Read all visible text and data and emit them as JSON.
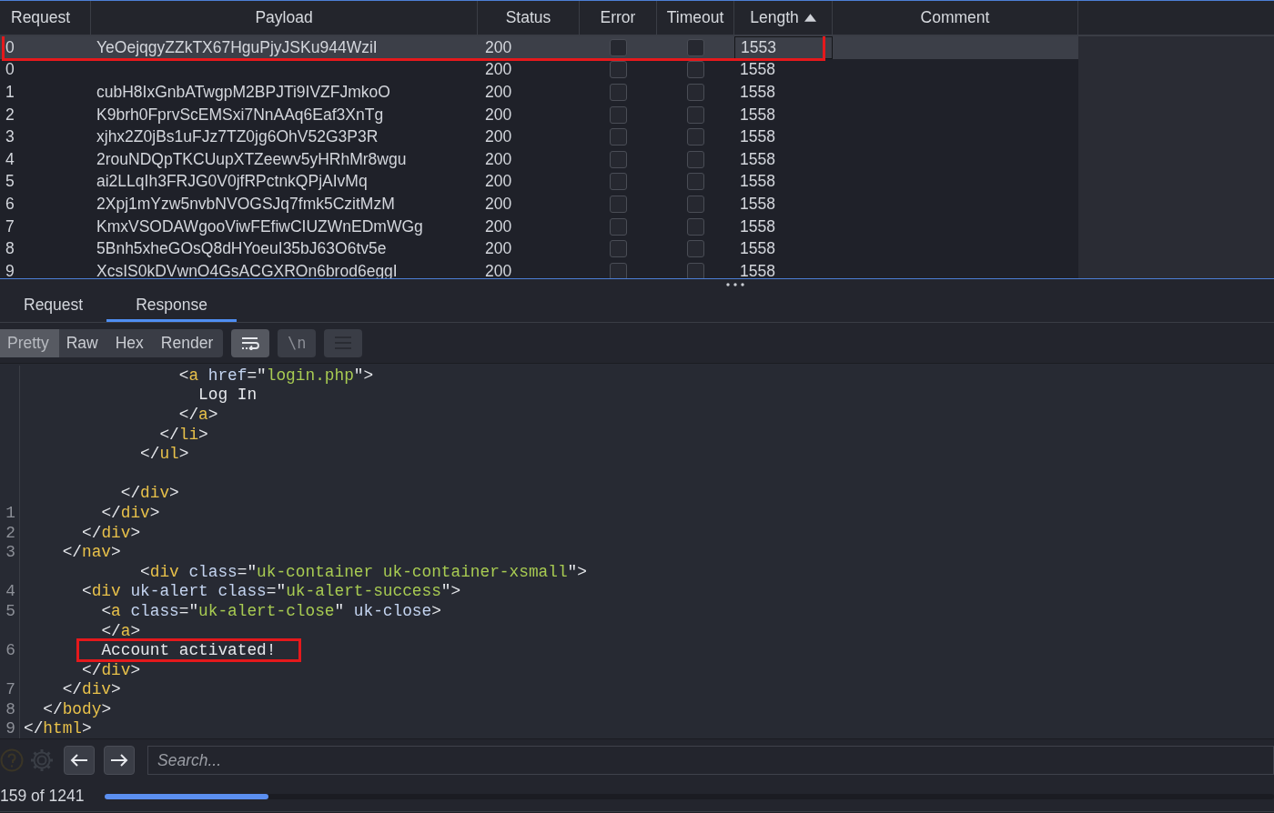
{
  "results_table": {
    "columns": [
      "Request",
      "Payload",
      "Status",
      "Error",
      "Timeout",
      "Length",
      "Comment"
    ],
    "rows": [
      {
        "request": "0",
        "payload": "YeOejqgyZZkTX67HguPjyJSKu944WziI",
        "status": "200",
        "error": false,
        "timeout": false,
        "length": "1553",
        "selected": true,
        "highlighted": true
      },
      {
        "request": "0",
        "status": "200",
        "error": false,
        "timeout": false,
        "length": "1558",
        "selected": false,
        "highlighted": false
      },
      {
        "request": "1",
        "payload": "cubH8IxGnbATwgpM2BPJTi9IVZFJmkoO",
        "status": "200",
        "error": false,
        "timeout": false,
        "length": "1558",
        "selected": false,
        "highlighted": false
      },
      {
        "request": "2",
        "payload": "K9brh0FprvScEMSxi7NnAAq6Eaf3XnTg",
        "status": "200",
        "error": false,
        "timeout": false,
        "length": "1558",
        "selected": false,
        "highlighted": false
      },
      {
        "request": "3",
        "payload": "xjhx2Z0jBs1uFJz7TZ0jg6OhV52G3P3R",
        "status": "200",
        "error": false,
        "timeout": false,
        "length": "1558",
        "selected": false,
        "highlighted": false
      },
      {
        "request": "4",
        "payload": "2rouNDQpTKCUupXTZeewv5yHRhMr8wgu",
        "status": "200",
        "error": false,
        "timeout": false,
        "length": "1558",
        "selected": false,
        "highlighted": false
      },
      {
        "request": "5",
        "payload": "ai2LLqIh3FRJG0V0jfRPctnkQPjAIvMq",
        "status": "200",
        "error": false,
        "timeout": false,
        "length": "1558",
        "selected": false,
        "highlighted": false
      },
      {
        "request": "6",
        "payload": "2Xpj1mYzw5nvbNVOGSJq7fmk5CzitMzM",
        "status": "200",
        "error": false,
        "timeout": false,
        "length": "1558",
        "selected": false,
        "highlighted": false
      },
      {
        "request": "7",
        "payload": "KmxVSODAWgooViwFEfiwCIUZWnEDmWGg",
        "status": "200",
        "error": false,
        "timeout": false,
        "length": "1558",
        "selected": false,
        "highlighted": false
      },
      {
        "request": "8",
        "payload": "5Bnh5xheGOsQ8dHYoeuI35bJ63O6tv5e",
        "status": "200",
        "error": false,
        "timeout": false,
        "length": "1558",
        "selected": false,
        "highlighted": false
      },
      {
        "request": "9",
        "payload": "XcsIS0kDVwnO4GsACGXROn6brod6eggI",
        "status": "200",
        "error": false,
        "timeout": false,
        "length": "1558",
        "selected": false,
        "highlighted": false
      }
    ]
  },
  "message_tabs": [
    {
      "label": "Request",
      "selected": false
    },
    {
      "label": "Response",
      "selected": true
    }
  ],
  "view_modes": [
    {
      "label": "Pretty",
      "selected": true
    },
    {
      "label": "Raw",
      "selected": false
    },
    {
      "label": "Hex",
      "selected": false
    },
    {
      "label": "Render",
      "selected": false
    }
  ],
  "view_options": [
    {
      "kind": "wrap",
      "on": true
    },
    {
      "kind": "newline",
      "label": "\\n",
      "on": false
    },
    {
      "kind": "menu",
      "on": false
    }
  ],
  "code_lines": [
    {
      "segs": [
        {
          "kind": "p",
          "t": "                <"
        },
        {
          "kind": "tag",
          "t": "a"
        },
        {
          "kind": "attr",
          "t": " href"
        },
        {
          "kind": "p",
          "t": "=\""
        },
        {
          "kind": "str",
          "t": "login.php"
        },
        {
          "kind": "p",
          "t": "\">"
        }
      ],
      "marked": false
    },
    {
      "segs": [
        {
          "kind": "text",
          "t": "                  Log In"
        }
      ],
      "marked": false
    },
    {
      "segs": [
        {
          "kind": "p",
          "t": "                </"
        },
        {
          "kind": "tag",
          "t": "a"
        },
        {
          "kind": "p",
          "t": ">"
        }
      ],
      "marked": false
    },
    {
      "segs": [
        {
          "kind": "p",
          "t": "              </"
        },
        {
          "kind": "tag",
          "t": "li"
        },
        {
          "kind": "p",
          "t": ">"
        }
      ],
      "marked": false
    },
    {
      "segs": [
        {
          "kind": "p",
          "t": "            </"
        },
        {
          "kind": "tag",
          "t": "ul"
        },
        {
          "kind": "p",
          "t": ">"
        }
      ],
      "marked": false
    },
    {
      "marked": false
    },
    {
      "segs": [
        {
          "kind": "p",
          "t": "          </"
        },
        {
          "kind": "tag",
          "t": "div"
        },
        {
          "kind": "p",
          "t": ">"
        }
      ],
      "marked": false
    },
    {
      "number": "1",
      "segs": [
        {
          "kind": "p",
          "t": "        </"
        },
        {
          "kind": "tag",
          "t": "div"
        },
        {
          "kind": "p",
          "t": ">"
        }
      ],
      "marked": false
    },
    {
      "number": "2",
      "segs": [
        {
          "kind": "p",
          "t": "      </"
        },
        {
          "kind": "tag",
          "t": "div"
        },
        {
          "kind": "p",
          "t": ">"
        }
      ],
      "marked": false
    },
    {
      "number": "3",
      "segs": [
        {
          "kind": "p",
          "t": "    </"
        },
        {
          "kind": "tag",
          "t": "nav"
        },
        {
          "kind": "p",
          "t": ">"
        }
      ],
      "marked": false
    },
    {
      "segs": [
        {
          "kind": "p",
          "t": "            <"
        },
        {
          "kind": "tag",
          "t": "div"
        },
        {
          "kind": "attr",
          "t": " class"
        },
        {
          "kind": "p",
          "t": "=\""
        },
        {
          "kind": "str",
          "t": "uk-container uk-container-xsmall"
        },
        {
          "kind": "p",
          "t": "\">"
        }
      ],
      "marked": false
    },
    {
      "number": "4",
      "segs": [
        {
          "kind": "p",
          "t": "      <"
        },
        {
          "kind": "tag",
          "t": "div"
        },
        {
          "kind": "attr",
          "t": " uk-alert class"
        },
        {
          "kind": "p",
          "t": "=\""
        },
        {
          "kind": "str",
          "t": "uk-alert-success"
        },
        {
          "kind": "p",
          "t": "\">"
        }
      ],
      "marked": false
    },
    {
      "number": "5",
      "segs": [
        {
          "kind": "p",
          "t": "        <"
        },
        {
          "kind": "tag",
          "t": "a"
        },
        {
          "kind": "attr",
          "t": " class"
        },
        {
          "kind": "p",
          "t": "=\""
        },
        {
          "kind": "str",
          "t": "uk-alert-close"
        },
        {
          "kind": "p",
          "t": "\""
        },
        {
          "kind": "attr",
          "t": " uk-close"
        },
        {
          "kind": "p",
          "t": ">"
        }
      ],
      "marked": false
    },
    {
      "segs": [
        {
          "kind": "p",
          "t": "        </"
        },
        {
          "kind": "tag",
          "t": "a"
        },
        {
          "kind": "p",
          "t": ">"
        }
      ],
      "marked": false
    },
    {
      "number": "6",
      "segs": [
        {
          "kind": "text",
          "t": "        Account activated!"
        }
      ],
      "marked": true
    },
    {
      "segs": [
        {
          "kind": "p",
          "t": "      </"
        },
        {
          "kind": "tag",
          "t": "div"
        },
        {
          "kind": "p",
          "t": ">"
        }
      ],
      "marked": false
    },
    {
      "number": "7",
      "segs": [
        {
          "kind": "p",
          "t": "    </"
        },
        {
          "kind": "tag",
          "t": "div"
        },
        {
          "kind": "p",
          "t": ">"
        }
      ],
      "marked": false
    },
    {
      "number": "8",
      "segs": [
        {
          "kind": "p",
          "t": "  </"
        },
        {
          "kind": "tag",
          "t": "body"
        },
        {
          "kind": "p",
          "t": ">"
        }
      ],
      "marked": false
    },
    {
      "number": "9",
      "segs": [
        {
          "kind": "p",
          "t": "</"
        },
        {
          "kind": "tag",
          "t": "html"
        },
        {
          "kind": "p",
          "t": ">"
        }
      ],
      "marked": false
    }
  ],
  "search": {
    "placeholder": "Search..."
  },
  "status": {
    "count": "159 of 1241",
    "level": 0.14
  }
}
